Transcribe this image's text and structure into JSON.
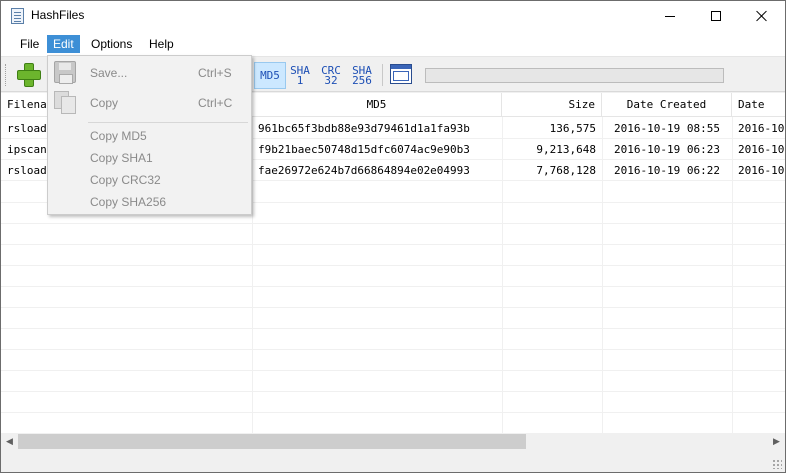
{
  "window": {
    "title": "HashFiles"
  },
  "menu": {
    "file": "File",
    "edit": "Edit",
    "options": "Options",
    "help": "Help"
  },
  "toolbar": {
    "md5": "MD5",
    "sha1": [
      "SHA",
      "1"
    ],
    "crc32": [
      "CRC",
      "32"
    ],
    "sha256": [
      "SHA",
      "256"
    ],
    "progress": 0
  },
  "columns": [
    "Filename",
    "MD5",
    "Size",
    "Date Created",
    "Date"
  ],
  "rows": [
    {
      "filename": "rsload",
      "md5": "961bc65f3bdb88e93d79461d1a1fa93b",
      "size": "136,575",
      "created": "2016-10-19 08:55",
      "date2": "2016-10"
    },
    {
      "filename": "ipscan",
      "md5": "f9b21baec50748d15dfc6074ac9e90b3",
      "size": "9,213,648",
      "created": "2016-10-19 06:23",
      "date2": "2016-10"
    },
    {
      "filename": "rsload",
      "md5": "fae26972e624b7d66864894e02e04993",
      "size": "7,768,128",
      "created": "2016-10-19 06:22",
      "date2": "2016-10"
    }
  ],
  "edit_menu": {
    "save": {
      "label": "Save...",
      "shortcut": "Ctrl+S"
    },
    "copy": {
      "label": "Copy",
      "shortcut": "Ctrl+C"
    },
    "copy_md5": "Copy MD5",
    "copy_sha1": "Copy SHA1",
    "copy_crc32": "Copy CRC32",
    "copy_sha256": "Copy SHA256"
  },
  "icons": {
    "app": "document-hash-icon",
    "add": "plus-icon",
    "save": "floppy-disk-icon",
    "copy": "copy-icon",
    "window": "window-icon"
  },
  "colors": {
    "menu_highlight": "#3d8fd6",
    "selected_hash": "#cce8ff",
    "hash_text": "#1d4fb5",
    "disabled_text": "#8a8a8a"
  }
}
